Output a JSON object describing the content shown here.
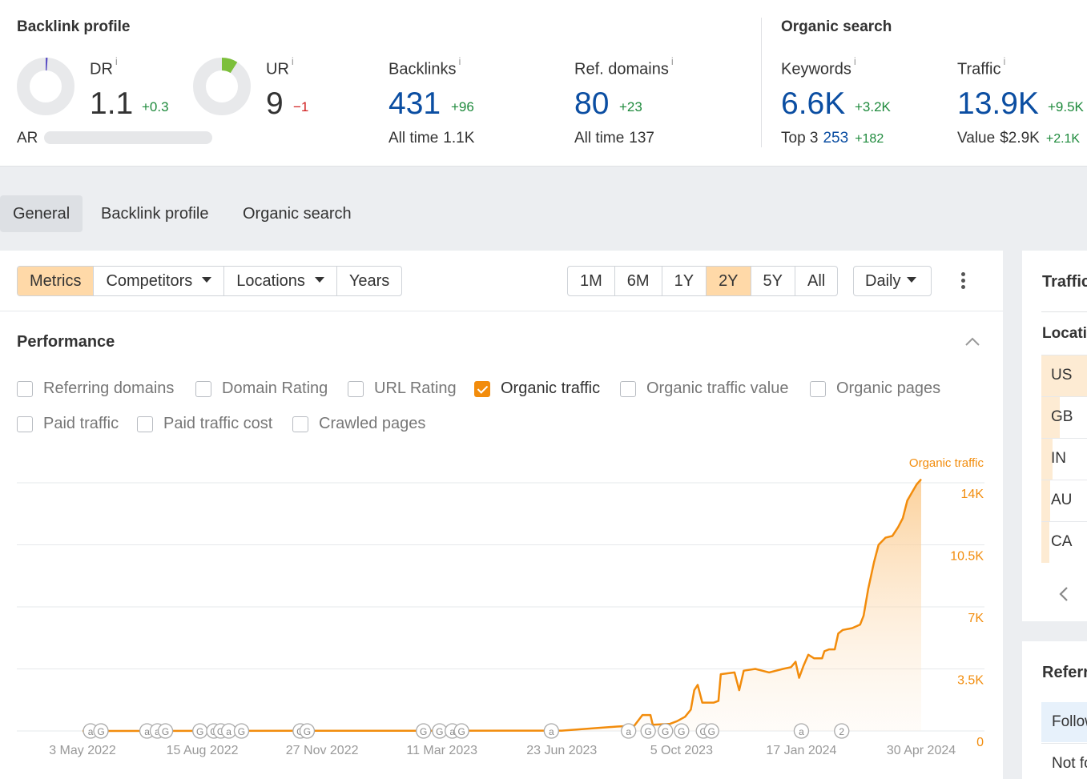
{
  "backlink_profile": {
    "title": "Backlink profile",
    "dr": {
      "label": "DR",
      "info": "i",
      "value": "1.1",
      "delta": "+0.3",
      "gauge_fraction": 0.011
    },
    "ur": {
      "label": "UR",
      "info": "i",
      "value": "9",
      "delta": "−1",
      "gauge_fraction": 0.09
    },
    "ar_label": "AR",
    "backlinks": {
      "label": "Backlinks",
      "info": "i",
      "value": "431",
      "delta": "+96",
      "sub_label": "All time",
      "sub_value": "1.1K"
    },
    "ref_domains": {
      "label": "Ref. domains",
      "info": "i",
      "value": "80",
      "delta": "+23",
      "sub_label": "All time",
      "sub_value": "137"
    }
  },
  "organic_search": {
    "title": "Organic search",
    "keywords": {
      "label": "Keywords",
      "info": "i",
      "value": "6.6K",
      "delta": "+3.2K",
      "sub_label": "Top 3",
      "sub_value": "253",
      "sub_delta": "+182"
    },
    "traffic": {
      "label": "Traffic",
      "info": "i",
      "value": "13.9K",
      "delta": "+9.5K",
      "sub_label": "Value",
      "sub_value": "$2.9K",
      "sub_delta": "+2.1K"
    }
  },
  "tabs": [
    "General",
    "Backlink profile",
    "Organic search"
  ],
  "toolbar": {
    "metrics": "Metrics",
    "competitors": "Competitors",
    "locations": "Locations",
    "years": "Years",
    "ranges": [
      "1M",
      "6M",
      "1Y",
      "2Y",
      "5Y",
      "All"
    ],
    "active_range": "2Y",
    "interval": "Daily"
  },
  "performance": {
    "title": "Performance",
    "checkboxes": [
      {
        "label": "Referring domains",
        "checked": false
      },
      {
        "label": "Domain Rating",
        "checked": false
      },
      {
        "label": "URL Rating",
        "checked": false
      },
      {
        "label": "Organic traffic",
        "checked": true
      },
      {
        "label": "Organic traffic value",
        "checked": false
      },
      {
        "label": "Organic pages",
        "checked": false
      },
      {
        "label": "Paid traffic",
        "checked": false
      },
      {
        "label": "Paid traffic cost",
        "checked": false
      },
      {
        "label": "Crawled pages",
        "checked": false
      }
    ]
  },
  "chart_data": {
    "type": "area",
    "series": [
      {
        "name": "Organic traffic",
        "color": "#f28c0c"
      }
    ],
    "x_tick_labels": [
      "3 May 2022",
      "15 Aug 2022",
      "27 Nov 2022",
      "11 Mar 2023",
      "23 Jun 2023",
      "5 Oct 2023",
      "17 Jan 2024",
      "30 Apr 2024"
    ],
    "y_tick_labels": [
      "0",
      "3.5K",
      "7K",
      "10.5K",
      "14K"
    ],
    "ylim": [
      0,
      14000
    ],
    "grid": true,
    "legend_label": "Organic traffic",
    "points": [
      [
        "2022-05-03",
        0
      ],
      [
        "2023-06-01",
        20
      ],
      [
        "2023-06-23",
        20
      ],
      [
        "2023-08-10",
        250
      ],
      [
        "2023-08-25",
        300
      ],
      [
        "2023-09-01",
        900
      ],
      [
        "2023-09-08",
        900
      ],
      [
        "2023-09-10",
        350
      ],
      [
        "2023-09-25",
        400
      ],
      [
        "2023-10-01",
        550
      ],
      [
        "2023-10-08",
        800
      ],
      [
        "2023-10-13",
        1200
      ],
      [
        "2023-10-16",
        2300
      ],
      [
        "2023-10-19",
        2600
      ],
      [
        "2023-10-23",
        1600
      ],
      [
        "2023-11-02",
        1600
      ],
      [
        "2023-11-06",
        1700
      ],
      [
        "2023-11-08",
        3200
      ],
      [
        "2023-11-20",
        3300
      ],
      [
        "2023-11-24",
        2300
      ],
      [
        "2023-11-28",
        3400
      ],
      [
        "2023-12-08",
        3500
      ],
      [
        "2023-12-20",
        3300
      ],
      [
        "2024-01-01",
        3500
      ],
      [
        "2024-01-08",
        3600
      ],
      [
        "2024-01-12",
        3900
      ],
      [
        "2024-01-15",
        3000
      ],
      [
        "2024-01-19",
        3700
      ],
      [
        "2024-01-23",
        4300
      ],
      [
        "2024-01-28",
        4100
      ],
      [
        "2024-02-04",
        4100
      ],
      [
        "2024-02-06",
        4500
      ],
      [
        "2024-02-10",
        4600
      ],
      [
        "2024-02-15",
        4600
      ],
      [
        "2024-02-18",
        5500
      ],
      [
        "2024-02-22",
        5700
      ],
      [
        "2024-03-01",
        5800
      ],
      [
        "2024-03-08",
        6000
      ],
      [
        "2024-03-11",
        6500
      ],
      [
        "2024-03-15",
        8000
      ],
      [
        "2024-03-20",
        9500
      ],
      [
        "2024-03-24",
        10500
      ],
      [
        "2024-03-30",
        10900
      ],
      [
        "2024-04-05",
        11000
      ],
      [
        "2024-04-10",
        11500
      ],
      [
        "2024-04-14",
        12000
      ],
      [
        "2024-04-18",
        13000
      ],
      [
        "2024-04-26",
        13900
      ],
      [
        "2024-04-30",
        14200
      ]
    ],
    "annotation_markers": [
      {
        "date": "2022-05-10",
        "label": "a"
      },
      {
        "date": "2022-05-19",
        "label": "G"
      },
      {
        "date": "2022-06-28",
        "label": "a"
      },
      {
        "date": "2022-07-07",
        "label": "a"
      },
      {
        "date": "2022-07-14",
        "label": "G"
      },
      {
        "date": "2022-08-13",
        "label": "G"
      },
      {
        "date": "2022-08-25",
        "label": "G"
      },
      {
        "date": "2022-08-31",
        "label": "G"
      },
      {
        "date": "2022-09-07",
        "label": "a"
      },
      {
        "date": "2022-09-18",
        "label": "G"
      },
      {
        "date": "2022-11-08",
        "label": "G"
      },
      {
        "date": "2022-11-14",
        "label": "G"
      },
      {
        "date": "2023-02-23",
        "label": "G"
      },
      {
        "date": "2023-03-09",
        "label": "G"
      },
      {
        "date": "2023-03-20",
        "label": "a"
      },
      {
        "date": "2023-03-28",
        "label": "G"
      },
      {
        "date": "2023-06-14",
        "label": "a"
      },
      {
        "date": "2023-08-20",
        "label": "a"
      },
      {
        "date": "2023-09-06",
        "label": "G"
      },
      {
        "date": "2023-09-21",
        "label": "G"
      },
      {
        "date": "2023-10-05",
        "label": "G"
      },
      {
        "date": "2023-10-24",
        "label": "G"
      },
      {
        "date": "2023-10-31",
        "label": "G"
      },
      {
        "date": "2024-01-17",
        "label": "a"
      },
      {
        "date": "2024-02-21",
        "label": "2"
      }
    ]
  },
  "right_panel": {
    "title": "Traffic",
    "locations_title": "Locations",
    "locations": [
      {
        "code": "US",
        "share": 1.0
      },
      {
        "code": "GB",
        "share": 0.4
      },
      {
        "code": "IN",
        "share": 0.25
      },
      {
        "code": "AU",
        "share": 0.2
      },
      {
        "code": "CA",
        "share": 0.18
      }
    ],
    "back_icon": "chevron-left-icon",
    "referring_title": "Referring",
    "referring_rows": [
      "Follow",
      "Not follow"
    ]
  }
}
